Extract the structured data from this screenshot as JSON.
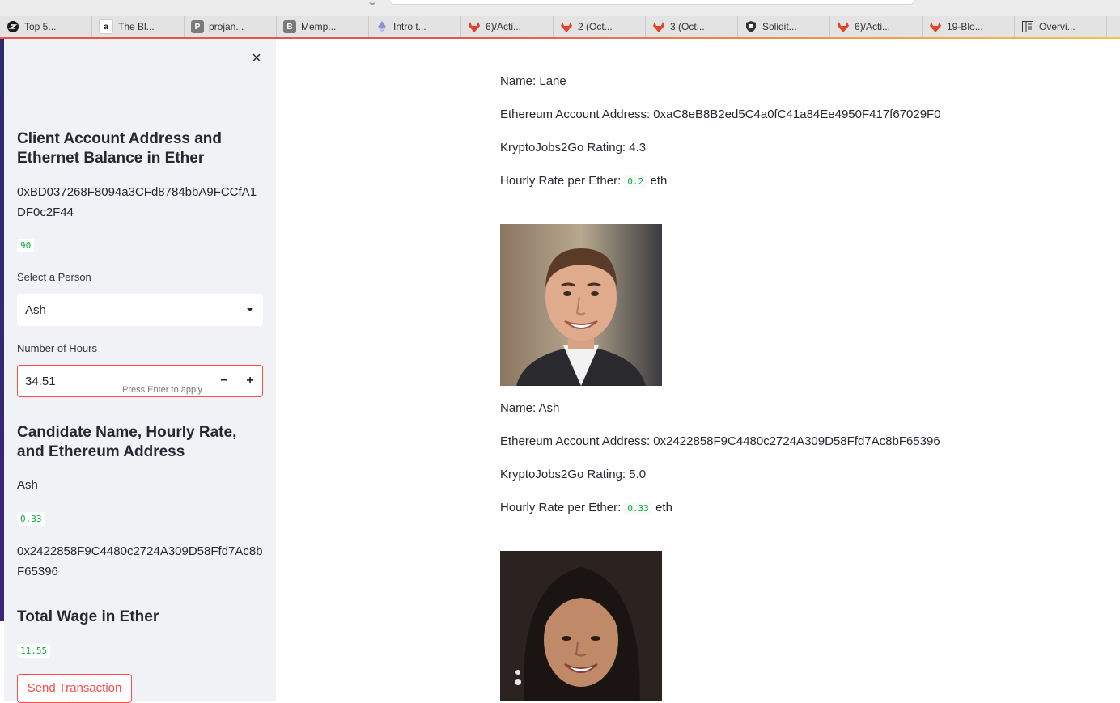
{
  "browser": {
    "tabs": [
      {
        "label": "Top 5...",
        "icon": "z-logo-icon",
        "color": "#1a1a1a"
      },
      {
        "label": "The Bl...",
        "icon": "amazon-icon",
        "color": "#1a1a1a"
      },
      {
        "label": "projan...",
        "icon": "p-icon",
        "color": "#6b6b6b"
      },
      {
        "label": "Memp...",
        "icon": "b-icon",
        "color": "#6b6b6b"
      },
      {
        "label": "Intro t...",
        "icon": "ethereum-icon",
        "color": "#8a92d9"
      },
      {
        "label": "6)/Acti...",
        "icon": "gitlab-icon",
        "color": "#e2432a"
      },
      {
        "label": "2 (Oct...",
        "icon": "gitlab-icon",
        "color": "#e2432a"
      },
      {
        "label": "3 (Oct...",
        "icon": "gitlab-icon",
        "color": "#e2432a"
      },
      {
        "label": "Solidit...",
        "icon": "shield-icon",
        "color": "#333333"
      },
      {
        "label": "6)/Acti...",
        "icon": "gitlab-icon",
        "color": "#e2432a"
      },
      {
        "label": "19-Blo...",
        "icon": "gitlab-icon",
        "color": "#e2432a"
      },
      {
        "label": "Overvi...",
        "icon": "columns-icon",
        "color": "#333333"
      }
    ]
  },
  "sidebar": {
    "close_icon": "×",
    "client_heading": "Client Account Address and Ethernet Balance in Ether",
    "client_address": "0xBD037268F8094a3CFd8784bbA9FCCfA1DF0c2F44",
    "client_balance": "90",
    "select_label": "Select a Person",
    "select_value": "Ash",
    "hours_label": "Number of Hours",
    "hours_value": "34.51",
    "hours_hint": "Press Enter to apply",
    "minus": "−",
    "plus": "+",
    "candidate_heading": "Candidate Name, Hourly Rate, and Ethereum Address",
    "candidate_name": "Ash",
    "candidate_rate": "0.33",
    "candidate_address": "0x2422858F9C4480c2724A309D58Ffd7Ac8bF65396",
    "wage_heading": "Total Wage in Ether",
    "wage_value": "11.55",
    "send_button": "Send Transaction"
  },
  "main": {
    "people": [
      {
        "name_line": "Name: Lane",
        "address_line": "Ethereum Account Address: 0xaC8eB8B2ed5C4a0fC41a84Ee4950F417f67029F0",
        "rating_line": "KryptoJobs2Go Rating: 4.3",
        "rate_label": "Hourly Rate per Ether:",
        "rate_value": "0.2",
        "rate_unit": "eth"
      },
      {
        "name_line": "Name: Ash",
        "address_line": "Ethereum Account Address: 0x2422858F9C4480c2724A309D58Ffd7Ac8bF65396",
        "rating_line": "KryptoJobs2Go Rating: 5.0",
        "rate_label": "Hourly Rate per Ether:",
        "rate_value": "0.33",
        "rate_unit": "eth"
      }
    ]
  }
}
